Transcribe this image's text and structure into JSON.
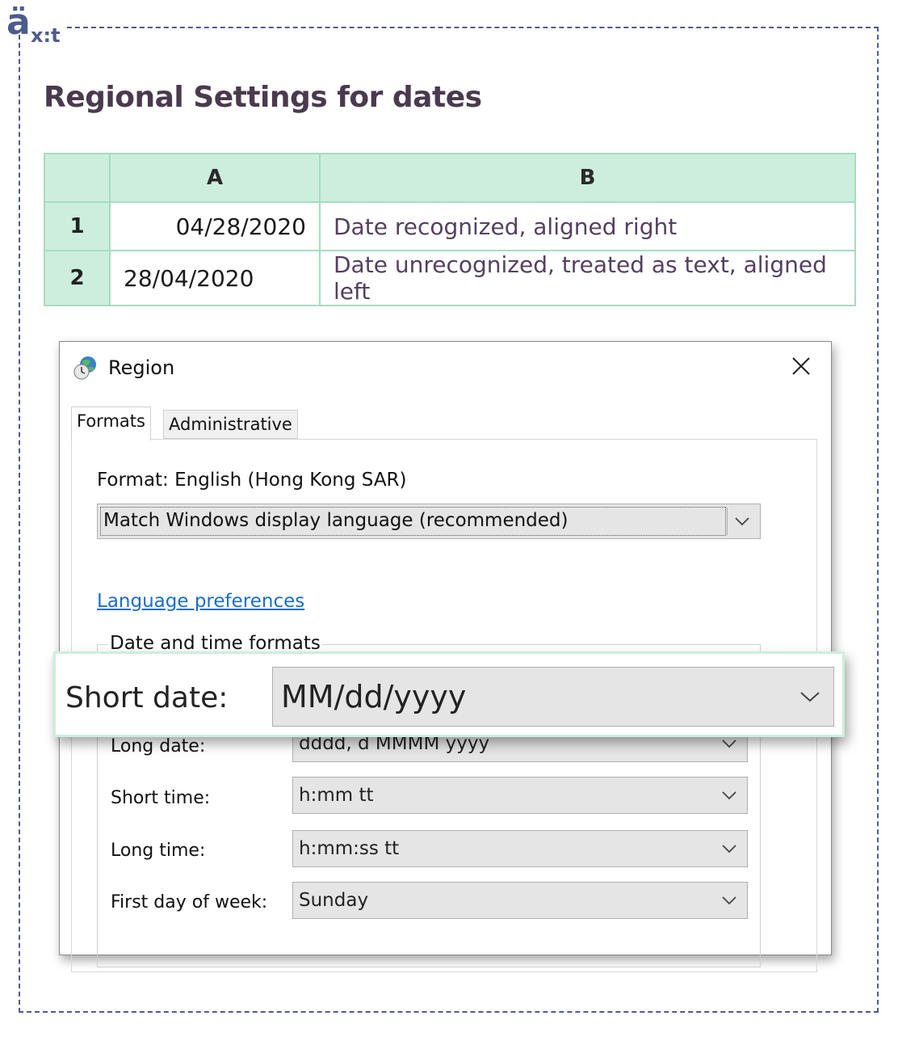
{
  "logo": {
    "text_big": "ä",
    "text_small": "x:t"
  },
  "page": {
    "title": "Regional Settings for dates"
  },
  "sheet": {
    "columns": [
      "A",
      "B"
    ],
    "rows": [
      {
        "num": "1",
        "a": "04/28/2020",
        "a_align": "right",
        "b": "Date recognized, aligned right"
      },
      {
        "num": "2",
        "a": "28/04/2020",
        "a_align": "left",
        "b": "Date unrecognized, treated as text, aligned left"
      }
    ]
  },
  "dialog": {
    "title": "Region",
    "tabs": [
      "Formats",
      "Administrative"
    ],
    "active_tab": "Formats",
    "format_label": "Format: English (Hong Kong SAR)",
    "format_select": "Match Windows display language (recommended)",
    "language_link": "Language preferences",
    "group_label": "Date and time formats",
    "fields": [
      {
        "label": "Short date:",
        "value": "MM/dd/yyyy"
      },
      {
        "label": "Long date:",
        "value": "dddd, d MMMM yyyy"
      },
      {
        "label": "Short time:",
        "value": "h:mm tt"
      },
      {
        "label": "Long time:",
        "value": "h:mm:ss tt"
      },
      {
        "label": "First day of week:",
        "value": "Sunday"
      }
    ]
  },
  "zoom": {
    "label": "Short date:",
    "value": "MM/dd/yyyy"
  },
  "colors": {
    "accent": "#4c5c8c",
    "header_bg": "#cdeedd",
    "link": "#1a6ec7",
    "title": "#4a3a4e"
  },
  "icons": [
    "globe-clock-icon",
    "close-icon",
    "chevron-down-icon"
  ]
}
